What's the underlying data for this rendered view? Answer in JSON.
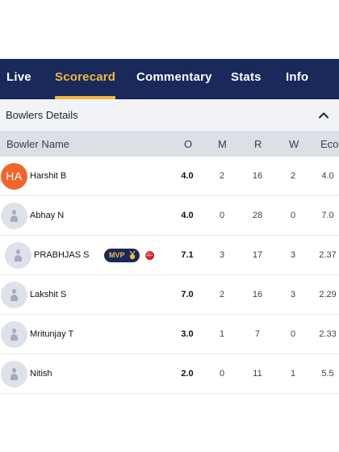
{
  "tabs": [
    {
      "label": "Live",
      "active": false
    },
    {
      "label": "Scorecard",
      "active": true
    },
    {
      "label": "Commentary",
      "active": false
    },
    {
      "label": "Stats",
      "active": false
    },
    {
      "label": "Info",
      "active": false
    }
  ],
  "section": {
    "title": "Bowlers Details",
    "icon": "chevron-up-icon"
  },
  "columns": {
    "name": "Bowler Name",
    "o": "O",
    "m": "M",
    "r": "R",
    "w": "W",
    "eco": "Eco"
  },
  "mvp_label": "MVP",
  "colors": {
    "nav_bg": "#18295a",
    "accent": "#f4b740",
    "initials_avatar": "#f0662e"
  },
  "bowlers": [
    {
      "initials": "HA",
      "name": "Harshit  B",
      "o": "4.0",
      "m": "2",
      "r": "16",
      "w": "2",
      "eco": "4.0"
    },
    {
      "name": "Abhay  N",
      "o": "4.0",
      "m": "0",
      "r": "28",
      "w": "0",
      "eco": "7.0"
    },
    {
      "name": "PRABHJAS S",
      "o": "7.1",
      "m": "3",
      "r": "17",
      "w": "3",
      "eco": "2.37",
      "mvp": true
    },
    {
      "name": "Lakshit S",
      "o": "7.0",
      "m": "2",
      "r": "16",
      "w": "3",
      "eco": "2.29"
    },
    {
      "name": "Mritunjay T",
      "o": "3.0",
      "m": "1",
      "r": "7",
      "w": "0",
      "eco": "2.33"
    },
    {
      "name": "Nitish",
      "o": "2.0",
      "m": "0",
      "r": "11",
      "w": "1",
      "eco": "5.5"
    }
  ]
}
